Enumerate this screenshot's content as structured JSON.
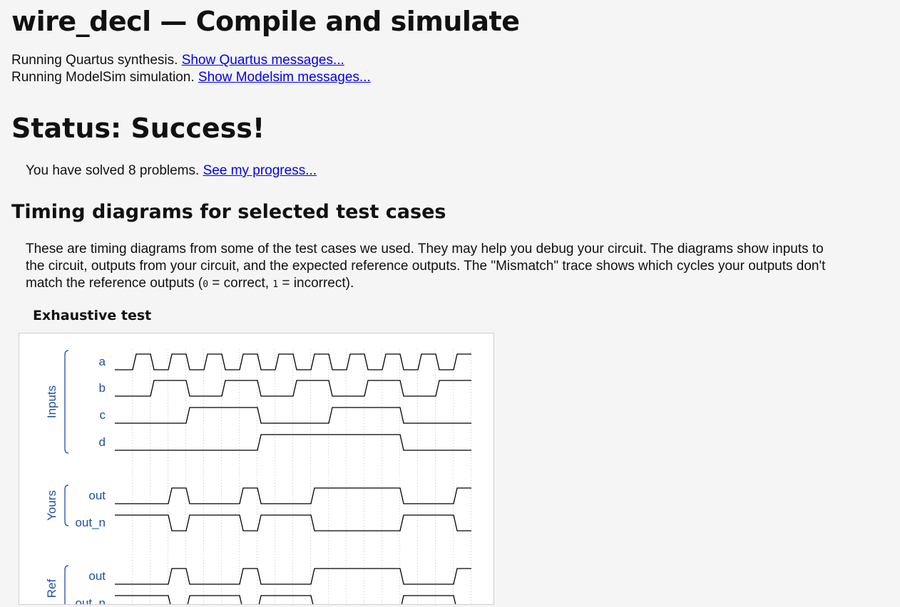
{
  "header": {
    "title": "wire_decl — Compile and simulate"
  },
  "run": {
    "quartus_text": "Running Quartus synthesis.",
    "quartus_link": "Show Quartus messages...",
    "modelsim_text": "Running ModelSim simulation.",
    "modelsim_link": "Show Modelsim messages..."
  },
  "status": {
    "heading": "Status: Success!",
    "solved_text": "You have solved 8 problems.",
    "progress_link": "See my progress..."
  },
  "timing": {
    "heading": "Timing diagrams for selected test cases",
    "para_line1": "These are timing diagrams from some of the test cases we used. They may help you debug your circuit. The diagrams show inputs to",
    "para_line2": "the circuit, outputs from your circuit, and the expected reference outputs. The \"Mismatch\" trace shows which cycles your outputs don't",
    "para_line3a": "match the reference outputs (",
    "zero": "0",
    "para_line3b": " = correct, ",
    "one": "1",
    "para_line3c": " = incorrect).",
    "test_title": "Exhaustive test"
  },
  "waveform": {
    "groups": [
      {
        "label": "Inputs",
        "signals": [
          "a",
          "b",
          "c",
          "d"
        ]
      },
      {
        "label": "Yours",
        "signals": [
          "out",
          "out_n"
        ]
      },
      {
        "label": "Ref",
        "signals": [
          "out",
          "out_n"
        ]
      }
    ],
    "traces": {
      "a": [
        0,
        1,
        0,
        1,
        0,
        1,
        0,
        1,
        0,
        1,
        0,
        1,
        0,
        1,
        0,
        1,
        0,
        1,
        0,
        1
      ],
      "b": [
        0,
        0,
        1,
        1,
        0,
        0,
        1,
        1,
        0,
        0,
        1,
        1,
        0,
        0,
        1,
        1,
        0,
        0,
        1,
        1
      ],
      "c": [
        0,
        0,
        0,
        0,
        1,
        1,
        1,
        1,
        0,
        0,
        0,
        0,
        1,
        1,
        1,
        1,
        0,
        0,
        0,
        0
      ],
      "d": [
        0,
        0,
        0,
        0,
        0,
        0,
        0,
        0,
        1,
        1,
        1,
        1,
        1,
        1,
        1,
        1,
        0,
        0,
        0,
        0
      ],
      "yours_out": [
        0,
        0,
        0,
        1,
        0,
        0,
        0,
        1,
        0,
        0,
        0,
        1,
        1,
        1,
        1,
        1,
        0,
        0,
        0,
        1
      ],
      "yours_out_n": [
        1,
        1,
        1,
        0,
        1,
        1,
        1,
        0,
        1,
        1,
        1,
        0,
        0,
        0,
        0,
        0,
        1,
        1,
        1,
        0
      ],
      "ref_out": [
        0,
        0,
        0,
        1,
        0,
        0,
        0,
        1,
        0,
        0,
        0,
        1,
        1,
        1,
        1,
        1,
        0,
        0,
        0,
        1
      ],
      "ref_out_n": [
        1,
        1,
        1,
        0,
        1,
        1,
        1,
        0,
        1,
        1,
        1,
        0,
        0,
        0,
        0,
        0,
        1,
        1,
        1,
        0
      ]
    },
    "colors": {
      "label": "#1f4ea8",
      "trace": "#000000",
      "grid": "#c8c8c8"
    }
  }
}
